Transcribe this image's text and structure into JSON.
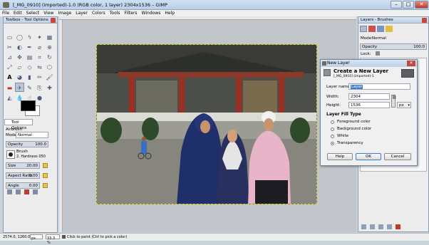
{
  "window": {
    "title": "[_MG_0910] (imported)-1.0 (RGB color, 1 layer) 2304x1536 – GIMP"
  },
  "menu": [
    "File",
    "Edit",
    "Select",
    "View",
    "Image",
    "Layer",
    "Colors",
    "Tools",
    "Filters",
    "Windows",
    "Help"
  ],
  "toolbox": {
    "title": "Toolbox - Tool Options",
    "tab_label": "Tool Options",
    "tool_name": "Airbrush",
    "mode_label": "Mode:",
    "mode_value": "Normal",
    "opacity_label": "Opacity",
    "opacity_value": "100.0",
    "brush_label": "Brush",
    "brush_value": "2. Hardness 050",
    "size_label": "Size",
    "size_value": "20.00",
    "aspect_label": "Aspect Ratio",
    "aspect_value": "0.00",
    "angle_label": "Angle",
    "angle_value": "0.00"
  },
  "status": {
    "coords": "2574.0, 1260.0",
    "unit": "px",
    "zoom": "33.3 %",
    "message": "Click to paint (Ctrl to pick a color)"
  },
  "dialog": {
    "title": "New Layer",
    "heading": "Create a New Layer",
    "subheading": "[_MG_0910] (imported)-1",
    "layer_name_label": "Layer name:",
    "layer_name_value": "Layer",
    "width_label": "Width:",
    "width_value": "2304",
    "height_label": "Height:",
    "height_value": "1536",
    "unit_value": "px",
    "fill_type_label": "Layer Fill Type",
    "fill_options": [
      "Foreground color",
      "Background color",
      "White",
      "Transparency"
    ],
    "fill_selected": "Transparency",
    "help_label": "Help",
    "ok_label": "OK",
    "cancel_label": "Cancel"
  },
  "layers_panel": {
    "title": "Layers - Brushes",
    "mode_label": "Mode:",
    "mode_value": "Normal",
    "opacity_label": "Opacity",
    "opacity_value": "100.0",
    "lock_label": "Lock:"
  },
  "colors": {
    "foreground": "#000000",
    "background": "#ffffff",
    "selection": "#3a7bd5"
  }
}
